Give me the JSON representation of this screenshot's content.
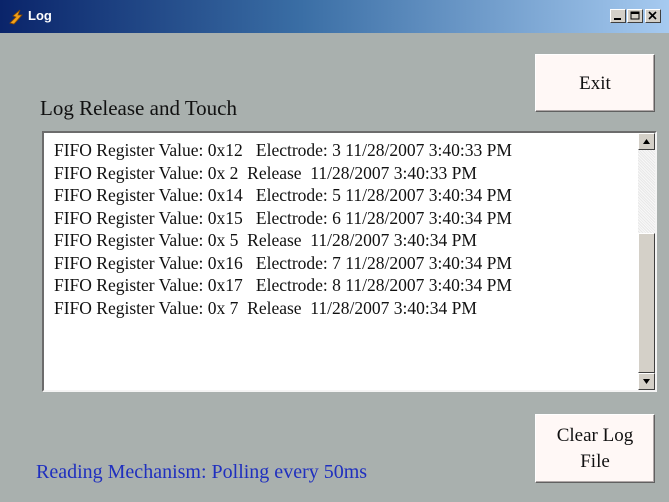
{
  "window": {
    "title": "Log",
    "colors": {
      "titlebar_start": "#0a246a",
      "titlebar_end": "#a6caf0",
      "background": "#a9b0ae",
      "status_text": "#1f2fbf"
    }
  },
  "header": {
    "label": "Log Release and Touch"
  },
  "buttons": {
    "exit_label": "Exit",
    "clear_line1": "Clear Log",
    "clear_line2": "File"
  },
  "log": {
    "items": [
      "FIFO Register Value: 0x12   Electrode: 3 11/28/2007 3:40:33 PM",
      "FIFO Register Value: 0x 2  Release  11/28/2007 3:40:33 PM",
      "FIFO Register Value: 0x14   Electrode: 5 11/28/2007 3:40:34 PM",
      "FIFO Register Value: 0x15   Electrode: 6 11/28/2007 3:40:34 PM",
      "FIFO Register Value: 0x 5  Release  11/28/2007 3:40:34 PM",
      "FIFO Register Value: 0x16   Electrode: 7 11/28/2007 3:40:34 PM",
      "FIFO Register Value: 0x17   Electrode: 8 11/28/2007 3:40:34 PM",
      "FIFO Register Value: 0x 7  Release  11/28/2007 3:40:34 PM"
    ]
  },
  "status": {
    "text": "Reading Mechanism:  Polling every 50ms"
  },
  "icons": {
    "app": "log-app-icon",
    "minimize": "minimize-icon",
    "maximize": "maximize-icon",
    "close": "close-icon",
    "scroll_up": "scroll-up-arrow-icon",
    "scroll_down": "scroll-down-arrow-icon"
  }
}
